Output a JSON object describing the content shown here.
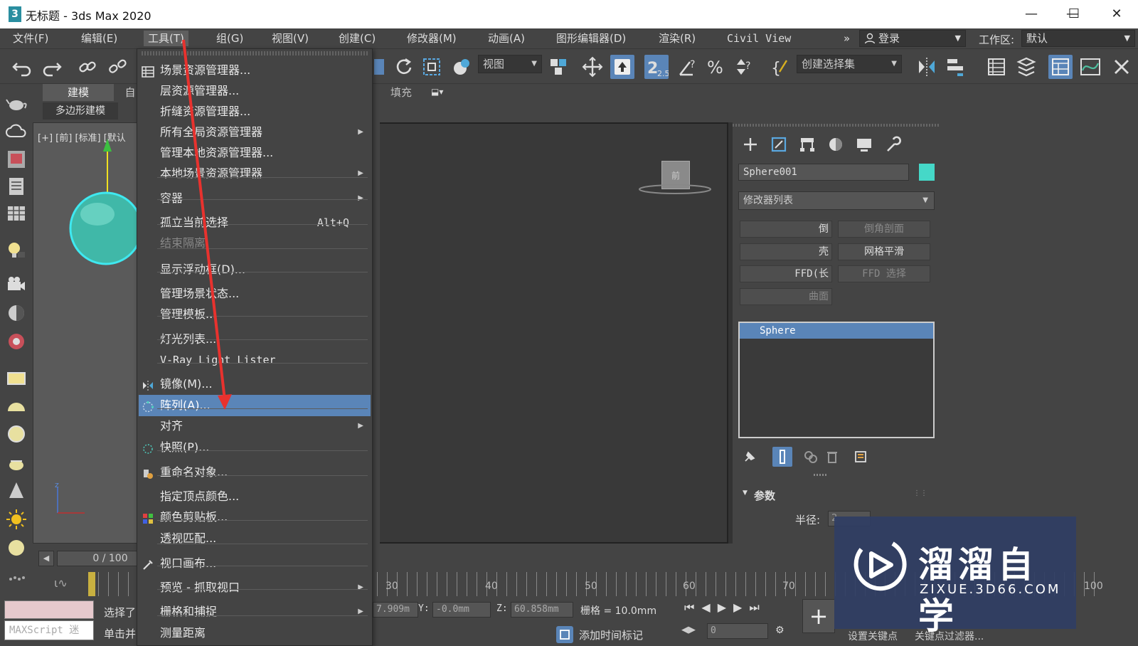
{
  "window": {
    "title": "无标题 - 3ds Max 2020",
    "app_icon_glyph": "3",
    "minimize": "—",
    "maximize": "☐",
    "close": "✕"
  },
  "menubar": {
    "items": [
      "文件(F)",
      "编辑(E)",
      "工具(T)",
      "组(G)",
      "视图(V)",
      "创建(C)",
      "修改器(M)",
      "动画(A)",
      "图形编辑器(D)",
      "渲染(R)",
      "Civil View"
    ],
    "overflow": "»",
    "login": "登录",
    "workspace_label": "工作区:",
    "workspace_value": "默认"
  },
  "toolbar": {
    "view_dropdown": "视图",
    "selection_set_dropdown": "创建选择集",
    "snap_label": "2.5"
  },
  "ribbon": {
    "tabs": [
      "建模",
      "自"
    ],
    "sub_tab": "多边形建模",
    "fill_label": "填充"
  },
  "viewport_left": {
    "label": "[+] [前] [标准] [默认"
  },
  "viewcube": {
    "label": "前"
  },
  "command_panel": {
    "object_name": "Sphere001",
    "object_color": "#45d8c8",
    "modifier_list": "修改器列表",
    "modifier_buttons": [
      {
        "left": "倒",
        "right": "倒角剖面",
        "right_dim": true
      },
      {
        "left": "壳",
        "right": "网格平滑",
        "right_dim": false
      },
      {
        "left": "FFD(长",
        "right": "FFD 选择",
        "right_dim": true
      },
      {
        "left": "曲面",
        "right": "",
        "right_dim": false
      }
    ],
    "stack_item": "Sphere",
    "params_label": "参数",
    "radius_label": "半径:",
    "radius_value": "2"
  },
  "timeline": {
    "frame": "0 / 100",
    "ticks": [
      "30",
      "40",
      "50",
      "60",
      "70",
      "100"
    ],
    "x_value": "7.909m",
    "y_label": "Y:",
    "y_value": "-0.0mm",
    "z_label": "Z:",
    "z_value": "60.858mm",
    "grid_label": "栅格 = 10.0mm",
    "add_time_tag": "添加时间标记",
    "frame_input": "0",
    "set_key": "设置关键点",
    "key_filters": "关键点过滤器..."
  },
  "status": {
    "maxscript_placeholder": "MAXScript 迷",
    "line1": "选择了",
    "line2": "单击并"
  },
  "dropdown": {
    "items": [
      {
        "label": "场景资源管理器...",
        "icon": "table-icon"
      },
      {
        "label": "层资源管理器..."
      },
      {
        "label": "折缝资源管理器..."
      },
      {
        "label": "所有全局资源管理器",
        "submenu": true
      },
      {
        "label": "管理本地资源管理器..."
      },
      {
        "label": "本地场景资源管理器",
        "submenu": true
      },
      {
        "label": "容器",
        "submenu": true
      },
      {
        "label": "孤立当前选择",
        "shortcut": "Alt+Q"
      },
      {
        "label": "结束隔离",
        "disabled": true
      },
      {
        "label": "显示浮动框(D)..."
      },
      {
        "label": "管理场景状态..."
      },
      {
        "label": "管理模板..."
      },
      {
        "label": "灯光列表..."
      },
      {
        "label": "V-Ray Light Lister"
      },
      {
        "label": "镜像(M)...",
        "icon": "mirror-icon"
      },
      {
        "label": "阵列(A)...",
        "icon": "array-icon",
        "highlighted": true
      },
      {
        "label": "对齐",
        "submenu": true
      },
      {
        "label": "快照(P)...",
        "icon": "snapshot-icon"
      },
      {
        "label": "重命名对象...",
        "icon": "rename-icon"
      },
      {
        "label": "指定顶点颜色..."
      },
      {
        "label": "颜色剪贴板...",
        "icon": "color-clipboard-icon"
      },
      {
        "label": "透视匹配..."
      },
      {
        "label": "视口画布...",
        "icon": "brush-icon"
      },
      {
        "label": "预览 - 抓取视口",
        "submenu": true
      },
      {
        "label": "栅格和捕捉",
        "submenu": true
      },
      {
        "label": "测量距离"
      }
    ]
  },
  "watermark": {
    "title": "溜溜自学",
    "url": "ZIXUE.3D66.COM"
  },
  "colors": {
    "accent": "#5a85b8",
    "arrow": "#e8322e",
    "sphere": "#45d8c8",
    "watermark_bg": "#303e64"
  }
}
